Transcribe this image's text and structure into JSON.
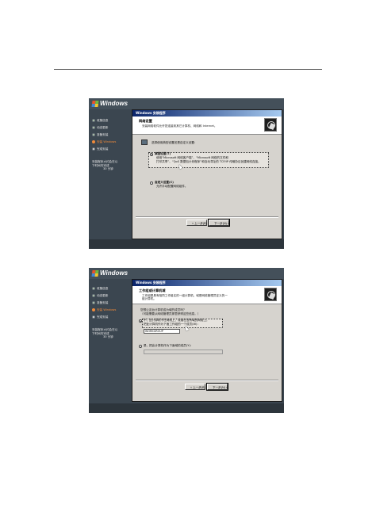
{
  "screens": [
    {
      "logo_text": "Windows",
      "steps": [
        {
          "label": "收集信息",
          "state": "done"
        },
        {
          "label": "动态更新",
          "state": "done"
        },
        {
          "label": "准备安装",
          "state": "done"
        },
        {
          "label": "安装 Windows",
          "state": "current"
        },
        {
          "label": "完成安装",
          "state": "pending"
        }
      ],
      "remaining_line1": "安装程序大约会在以",
      "remaining_line2": "下时间内完成",
      "remaining_line3": "30 分钟",
      "dialog_title": "Windows 安装程序",
      "header_title": "网络设置",
      "header_sub": "安装网络软件允许您连接到其它计算机、网络和 Internet。",
      "intro": "选择使用典型设置还是自定义设置：",
      "option1_label": "典型设置(T)",
      "option1_desc1": "使用“Microsoft 网络客户端”、“Microsoft 网络的文件和",
      "option1_desc2": "打印共享”、“QoS 数据包计划程序”和自动寻址的 TCP/IP 传输协议创建网络连接。",
      "option2_label": "自定义设置(C)",
      "option2_desc": "允许手动配置网络组件。",
      "back_button": "< 上一步(B)",
      "next_button": "下一步(N) >"
    },
    {
      "logo_text": "Windows",
      "steps": [
        {
          "label": "收集信息",
          "state": "done"
        },
        {
          "label": "动态更新",
          "state": "done"
        },
        {
          "label": "准备安装",
          "state": "done"
        },
        {
          "label": "安装 Windows",
          "state": "current"
        },
        {
          "label": "完成安装",
          "state": "pending"
        }
      ],
      "remaining_line1": "安装程序大约会在以",
      "remaining_line2": "下时间内完成",
      "remaining_line3": "30 分钟",
      "dialog_title": "Windows 安装程序",
      "header_title": "工作组或计算机域",
      "header_sub1": "工作组是具有相同工作组名的一组计算机。域是网络管理员定义的一",
      "header_sub2": "组计算机。",
      "question1": "您想让这台计算机成为域的成员吗？",
      "question2": "（可能需要从网络管理员那里获得这些信息。）",
      "option1_label1": "不，此计算机不在网络上，或者在没有域的网络上。",
      "option1_label2": "把此计算机作为下面工作组的一个成员(W)：",
      "workgroup_value": "WORKGROUP",
      "option2_label": "是，把此计算机作为下面域的成员(Y)：",
      "domain_value": "",
      "back_button": "< 上一步(B)",
      "next_button": "下一步(N) >"
    }
  ]
}
